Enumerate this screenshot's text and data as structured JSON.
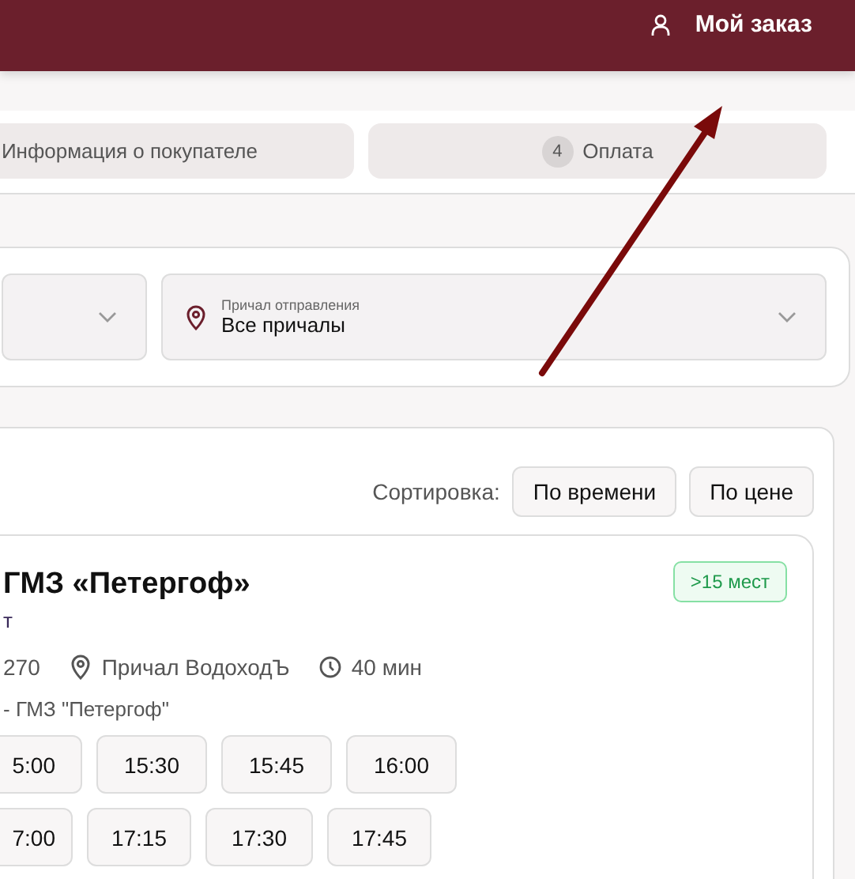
{
  "header": {
    "account_label": "Мой заказ"
  },
  "steps": [
    {
      "label": "Информация о покупателе"
    },
    {
      "number": "4",
      "label": "Оплата"
    }
  ],
  "filters": [
    {
      "kind": "blank"
    },
    {
      "kind": "pier",
      "label": "Причал отправления",
      "value": "Все причалы"
    }
  ],
  "sort": {
    "label": "Сортировка:",
    "options": [
      "По времени",
      "По цене"
    ]
  },
  "trip": {
    "title": "ГМЗ «Петергоф»",
    "subtitle": "т",
    "badge": ">15 мест",
    "price": "270",
    "pier": "Причал ВодоходЪ",
    "duration": "40 мин",
    "route": "- ГМЗ \"Петергоф\"",
    "time_rows": [
      [
        "5:00",
        "15:30",
        "15:45",
        "16:00"
      ],
      [
        "7:00",
        "17:15",
        "17:30",
        "17:45"
      ]
    ]
  }
}
